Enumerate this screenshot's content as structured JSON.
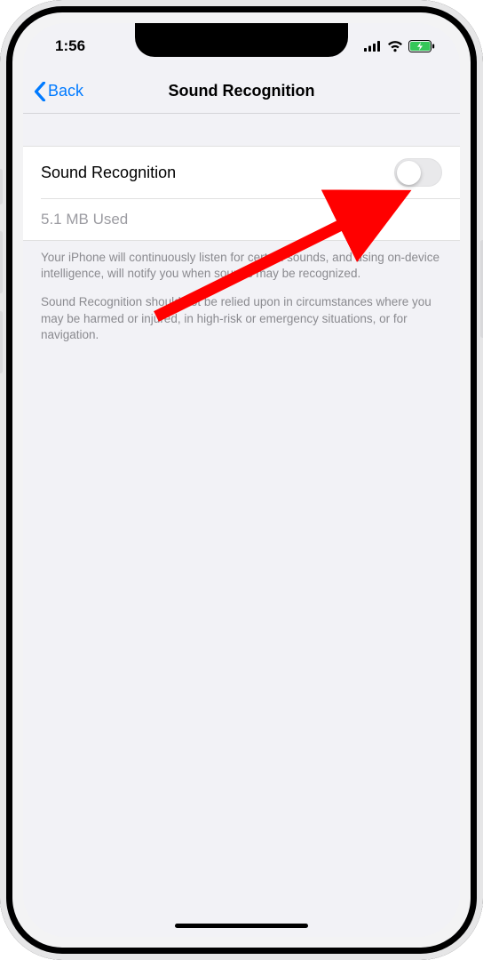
{
  "status": {
    "time": "1:56"
  },
  "nav": {
    "back_label": "Back",
    "title": "Sound Recognition"
  },
  "main": {
    "toggle_label": "Sound Recognition",
    "toggle_on": false,
    "storage_text": "5.1 MB Used"
  },
  "footer": {
    "p1": "Your iPhone will continuously listen for certain sounds, and using on-device intelligence, will notify you when sounds may be recognized.",
    "p2": "Sound Recognition should not be relied upon in circumstances where you may be harmed or injured, in high-risk or emergency situations, or for navigation."
  }
}
